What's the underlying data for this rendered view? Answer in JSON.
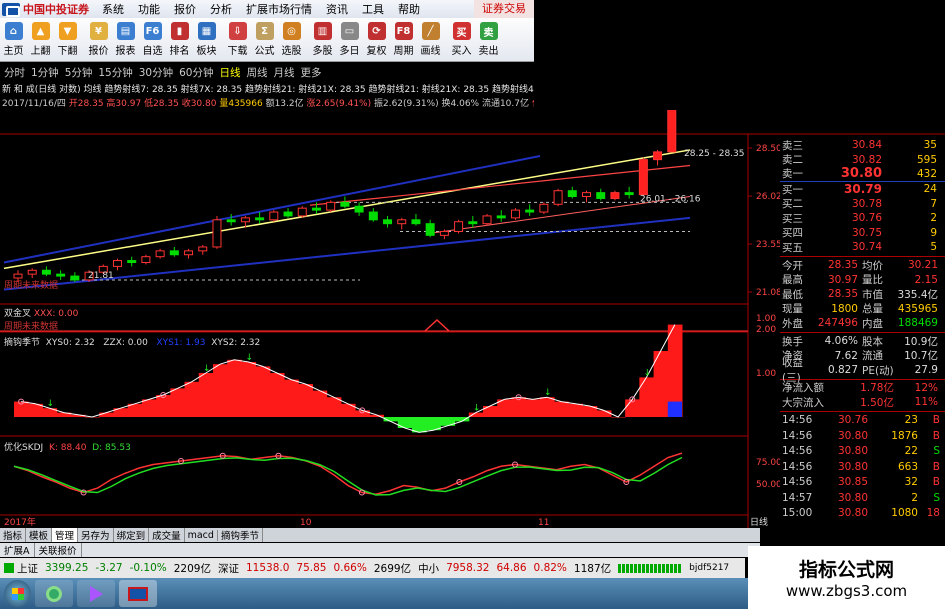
{
  "app": {
    "logo_text": "中国中投证券",
    "right_label": "证券交易"
  },
  "menu": [
    "系统",
    "功能",
    "报价",
    "分析",
    "扩展市场行情",
    "资讯",
    "工具",
    "帮助"
  ],
  "toolbar": [
    {
      "label": "主页",
      "color": "#3c7fd0",
      "icon": "home-icon"
    },
    {
      "label": "上翻",
      "color": "#f0a020",
      "icon": "up-arrow-icon"
    },
    {
      "label": "下翻",
      "color": "#f0a020",
      "icon": "down-arrow-icon"
    },
    {
      "label": "报价",
      "color": "#e0b040",
      "icon": "quote-icon"
    },
    {
      "label": "报表",
      "color": "#3c7fd0",
      "icon": "report-icon"
    },
    {
      "label": "自选",
      "color": "#3c7fd0",
      "icon": "favorites-icon"
    },
    {
      "label": "排名",
      "color": "#c03030",
      "icon": "rank-icon"
    },
    {
      "label": "板块",
      "color": "#3070c0",
      "icon": "sector-icon"
    },
    {
      "label": "下载",
      "color": "#d04040",
      "icon": "download-icon"
    },
    {
      "label": "公式",
      "color": "#c0a060",
      "icon": "formula-icon"
    },
    {
      "label": "选股",
      "color": "#d08020",
      "icon": "stock-pick-icon"
    },
    {
      "label": "多股",
      "color": "#c03030",
      "icon": "multi-stock-icon"
    },
    {
      "label": "多日",
      "color": "#888888",
      "icon": "multi-day-icon"
    },
    {
      "label": "复权",
      "color": "#c03030",
      "icon": "adjust-icon"
    },
    {
      "label": "周期",
      "color": "#c03030",
      "icon": "period-icon"
    },
    {
      "label": "画线",
      "color": "#c08030",
      "icon": "draw-line-icon"
    },
    {
      "label": "买入",
      "color": "#d03030",
      "icon": "buy-icon"
    },
    {
      "label": "卖出",
      "color": "#30a040",
      "icon": "sell-icon"
    }
  ],
  "periods": [
    "分时",
    "1分钟",
    "5分钟",
    "15分钟",
    "30分钟",
    "60分钟",
    "日线",
    "周线",
    "月线",
    "更多"
  ],
  "active_period": "日线",
  "info_line1": "新 和 成(日线 对数) 均线    趋势射线7: 28.35  射线7X: 28.35   趋势射线21: 射线21X: 28.35   趋势射线21: 射线21X: 28.35   趋势射线49",
  "info_line2": [
    {
      "text": "2017/11/16/四 ",
      "color": "#ccc"
    },
    {
      "text": "开28.35 ",
      "color": "#ff5050"
    },
    {
      "text": "高30.97 ",
      "color": "#ff5050"
    },
    {
      "text": "低28.35 ",
      "color": "#ff5050"
    },
    {
      "text": "收30.80 ",
      "color": "#ff5050"
    },
    {
      "text": "量435966 ",
      "color": "#ffcc00"
    },
    {
      "text": "额13.2亿 ",
      "color": "#ccc"
    },
    {
      "text": "涨2.65(9.41%) ",
      "color": "#ff5050"
    },
    {
      "text": "振2.62(9.31%) ",
      "color": "#ccc"
    },
    {
      "text": "换4.06% ",
      "color": "#ccc"
    },
    {
      "text": "流通10.7亿 ",
      "color": "#ccc"
    },
    {
      "text": "化学制药",
      "color": "#ff5050"
    }
  ],
  "price_axis": [
    "28.50",
    "26.02",
    "23.55",
    "21.08"
  ],
  "price_annotations": {
    "high": "28.25 - 28.35",
    "mid": "26.01 - 26.16",
    "low": "21.81"
  },
  "panel1_label": "周期未来数据",
  "panel1b": {
    "name": "双金叉",
    "field": "XXX: 0.00",
    "sub": "周期未来数据"
  },
  "panel1b_axis": [
    "1.00"
  ],
  "panel2": {
    "name": "摘钩季节",
    "f1": "XYS0: 2.32",
    "f2": "ZZX: 0.00",
    "f3": "XYS1: 1.93",
    "f4": "XYS2: 2.32"
  },
  "panel2_axis": [
    "2.00",
    "1.00"
  ],
  "panel3": {
    "name": "优化SKDJ",
    "f1": "K: 88.40",
    "f2": "D: 85.53"
  },
  "panel3_axis": [
    "75.00",
    "50.00"
  ],
  "date_axis": [
    "2017年",
    "10",
    "11"
  ],
  "period_label": "日线",
  "quote": {
    "asks": [
      [
        "卖三",
        "30.84",
        "35"
      ],
      [
        "卖二",
        "30.82",
        "595"
      ],
      [
        "卖一",
        "30.80",
        "432"
      ]
    ],
    "last": "30.80",
    "bids": [
      [
        "买一",
        "30.79",
        "24"
      ],
      [
        "买二",
        "30.78",
        "7"
      ],
      [
        "买三",
        "30.76",
        "2"
      ],
      [
        "买四",
        "30.75",
        "9"
      ],
      [
        "买五",
        "30.74",
        "5"
      ]
    ],
    "stats": [
      [
        "今开",
        "28.35",
        "均价",
        "30.21"
      ],
      [
        "最高",
        "30.97",
        "量比",
        "2.15"
      ],
      [
        "最低",
        "28.35",
        "市值",
        "335.4亿"
      ],
      [
        "现量",
        "1800",
        "总量",
        "435965"
      ],
      [
        "外盘",
        "247496",
        "内盘",
        "188469"
      ]
    ],
    "stats2": [
      [
        "换手",
        "4.06%",
        "股本",
        "10.9亿"
      ],
      [
        "净资",
        "7.62",
        "流通",
        "10.7亿"
      ],
      [
        "收益(三)",
        "0.827",
        "PE(动)",
        "27.9"
      ]
    ],
    "flows": [
      [
        "净流入额",
        "1.78亿",
        "12%"
      ],
      [
        "大宗流入",
        "1.50亿",
        "11%"
      ]
    ],
    "ticks": [
      [
        "14:56",
        "30.76",
        "23",
        "B"
      ],
      [
        "14:56",
        "30.80",
        "1876",
        "B"
      ],
      [
        "14:56",
        "30.80",
        "22",
        "S"
      ],
      [
        "14:56",
        "30.80",
        "663",
        "B"
      ],
      [
        "14:56",
        "30.85",
        "32",
        "B"
      ],
      [
        "14:57",
        "30.80",
        "2",
        "S"
      ],
      [
        "15:00",
        "30.80",
        "1080",
        "18"
      ]
    ]
  },
  "tabs": [
    "指标",
    "模板",
    "管理",
    "另存为",
    "绑定到",
    "成交量",
    "macd",
    "摘钩季节"
  ],
  "subtabs": [
    "扩展A",
    "关联报价"
  ],
  "status": {
    "sh_label": "上证",
    "sh_val": "3399.25",
    "sh_chg": "-3.27",
    "sh_pct": "-0.10%",
    "sh_amt": "2209亿",
    "sz_label": "深证",
    "sz_val": "11538.0",
    "sz_chg": "75.85",
    "sz_pct": "0.66%",
    "sz_amt": "2699亿",
    "zx_label": "中小",
    "zx_val": "7958.32",
    "zx_chg": "64.86",
    "zx_pct": "0.82%",
    "zx_amt": "1187亿",
    "tail": "bjdf5217"
  },
  "watermark": {
    "line1": "指标公式网",
    "line2": "www.zbgs3.com"
  },
  "colors": {
    "up": "#ff3333",
    "down": "#00dd00",
    "ma1": "#ffff88",
    "ma2": "#ff4444",
    "channel": "#2030c0"
  },
  "chart_data": {
    "type": "candlestick",
    "candles": [
      [
        21.8,
        22.2,
        21.6,
        22.0
      ],
      [
        22.0,
        22.3,
        21.8,
        22.2
      ],
      [
        22.2,
        22.4,
        21.9,
        22.0
      ],
      [
        22.0,
        22.2,
        21.7,
        21.9
      ],
      [
        21.9,
        22.1,
        21.6,
        21.7
      ],
      [
        21.7,
        22.2,
        21.6,
        22.1
      ],
      [
        22.1,
        22.5,
        22.0,
        22.4
      ],
      [
        22.4,
        22.8,
        22.2,
        22.7
      ],
      [
        22.7,
        22.9,
        22.4,
        22.6
      ],
      [
        22.6,
        23.0,
        22.5,
        22.9
      ],
      [
        22.9,
        23.3,
        22.8,
        23.2
      ],
      [
        23.2,
        23.4,
        22.9,
        23.0
      ],
      [
        23.0,
        23.3,
        22.8,
        23.2
      ],
      [
        23.2,
        23.5,
        23.0,
        23.4
      ],
      [
        23.4,
        25.0,
        23.3,
        24.8
      ],
      [
        24.8,
        25.1,
        24.5,
        24.7
      ],
      [
        24.7,
        25.0,
        24.4,
        24.9
      ],
      [
        24.9,
        25.2,
        24.6,
        24.8
      ],
      [
        24.8,
        25.3,
        24.7,
        25.2
      ],
      [
        25.2,
        25.4,
        24.9,
        25.0
      ],
      [
        25.0,
        25.5,
        24.9,
        25.4
      ],
      [
        25.4,
        25.7,
        25.1,
        25.3
      ],
      [
        25.3,
        25.8,
        25.2,
        25.7
      ],
      [
        25.7,
        26.0,
        25.4,
        25.5
      ],
      [
        25.5,
        25.7,
        25.0,
        25.2
      ],
      [
        25.2,
        25.4,
        24.7,
        24.8
      ],
      [
        24.8,
        25.0,
        24.4,
        24.6
      ],
      [
        24.6,
        24.9,
        24.3,
        24.8
      ],
      [
        24.8,
        25.1,
        24.5,
        24.6
      ],
      [
        24.6,
        24.8,
        23.9,
        24.0
      ],
      [
        24.0,
        24.3,
        23.8,
        24.2
      ],
      [
        24.2,
        24.8,
        24.1,
        24.7
      ],
      [
        24.7,
        25.0,
        24.4,
        24.6
      ],
      [
        24.6,
        25.1,
        24.5,
        25.0
      ],
      [
        25.0,
        25.3,
        24.7,
        24.9
      ],
      [
        24.9,
        25.4,
        24.8,
        25.3
      ],
      [
        25.3,
        25.6,
        25.0,
        25.2
      ],
      [
        25.2,
        25.7,
        25.1,
        25.6
      ],
      [
        25.6,
        26.4,
        25.5,
        26.3
      ],
      [
        26.3,
        26.5,
        25.9,
        26.0
      ],
      [
        26.0,
        26.3,
        25.7,
        26.2
      ],
      [
        26.2,
        26.4,
        25.8,
        25.9
      ],
      [
        25.9,
        26.3,
        25.8,
        26.2
      ],
      [
        26.2,
        26.5,
        25.9,
        26.1
      ],
      [
        26.1,
        28.0,
        26.0,
        27.9
      ],
      [
        27.9,
        28.4,
        27.6,
        28.3
      ],
      [
        28.3,
        30.97,
        28.3,
        30.8
      ]
    ],
    "ylim": [
      21.08,
      28.5
    ]
  }
}
